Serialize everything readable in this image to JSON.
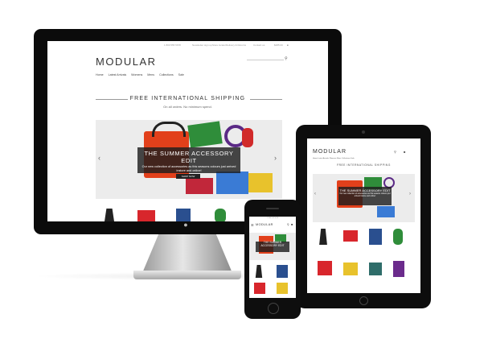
{
  "desktop": {
    "topbar": {
      "phone": "1 800 555 5678",
      "links": [
        "Newsletter sign up",
        "Store locator",
        "Delivery & Returns",
        "Contact us"
      ],
      "cart": "$485.00",
      "bag_count": "2"
    },
    "logo": "MODULAR",
    "nav": [
      "Home",
      "Latest Arrivals",
      "Womens",
      "Mens",
      "Collections",
      "Sale"
    ],
    "shipping_title": "FREE INTERNATIONAL SHIPPING",
    "shipping_sub": "On all orders. No minimum spend.",
    "hero": {
      "title": "THE SUMMER ACCESSORY EDIT",
      "subtitle": "Our new collection of accessories as this seasons colours just arrived instore and online!",
      "cta": "SHOP NOW",
      "prev": "‹",
      "next": "›"
    }
  },
  "tablet": {
    "logo": "MODULAR",
    "nav": [
      "Home",
      "Latest Arrivals",
      "Womens",
      "Mens",
      "Collections",
      "Sale"
    ],
    "shipping_title": "FREE INTERNATIONAL SHIPPING",
    "hero": {
      "title": "THE SUMMER ACCESSORY EDIT",
      "subtitle": "Our new collection of accessories as this seasons colours just arrived instore and online!",
      "prev": "‹",
      "next": "›"
    }
  },
  "phone": {
    "topbar": "1 800 555 5678",
    "logo": "MODULAR",
    "menu_label": "Menu",
    "hero": {
      "title": "THE SUMMER ACCESSORY EDIT"
    }
  },
  "colors": {
    "device_frame": "#0b0b0b",
    "caption_bg": "#1e1e1e",
    "bag_orange": "#e2401b",
    "bag_green": "#2f8d3a",
    "accent_purple": "#5b2a86"
  }
}
